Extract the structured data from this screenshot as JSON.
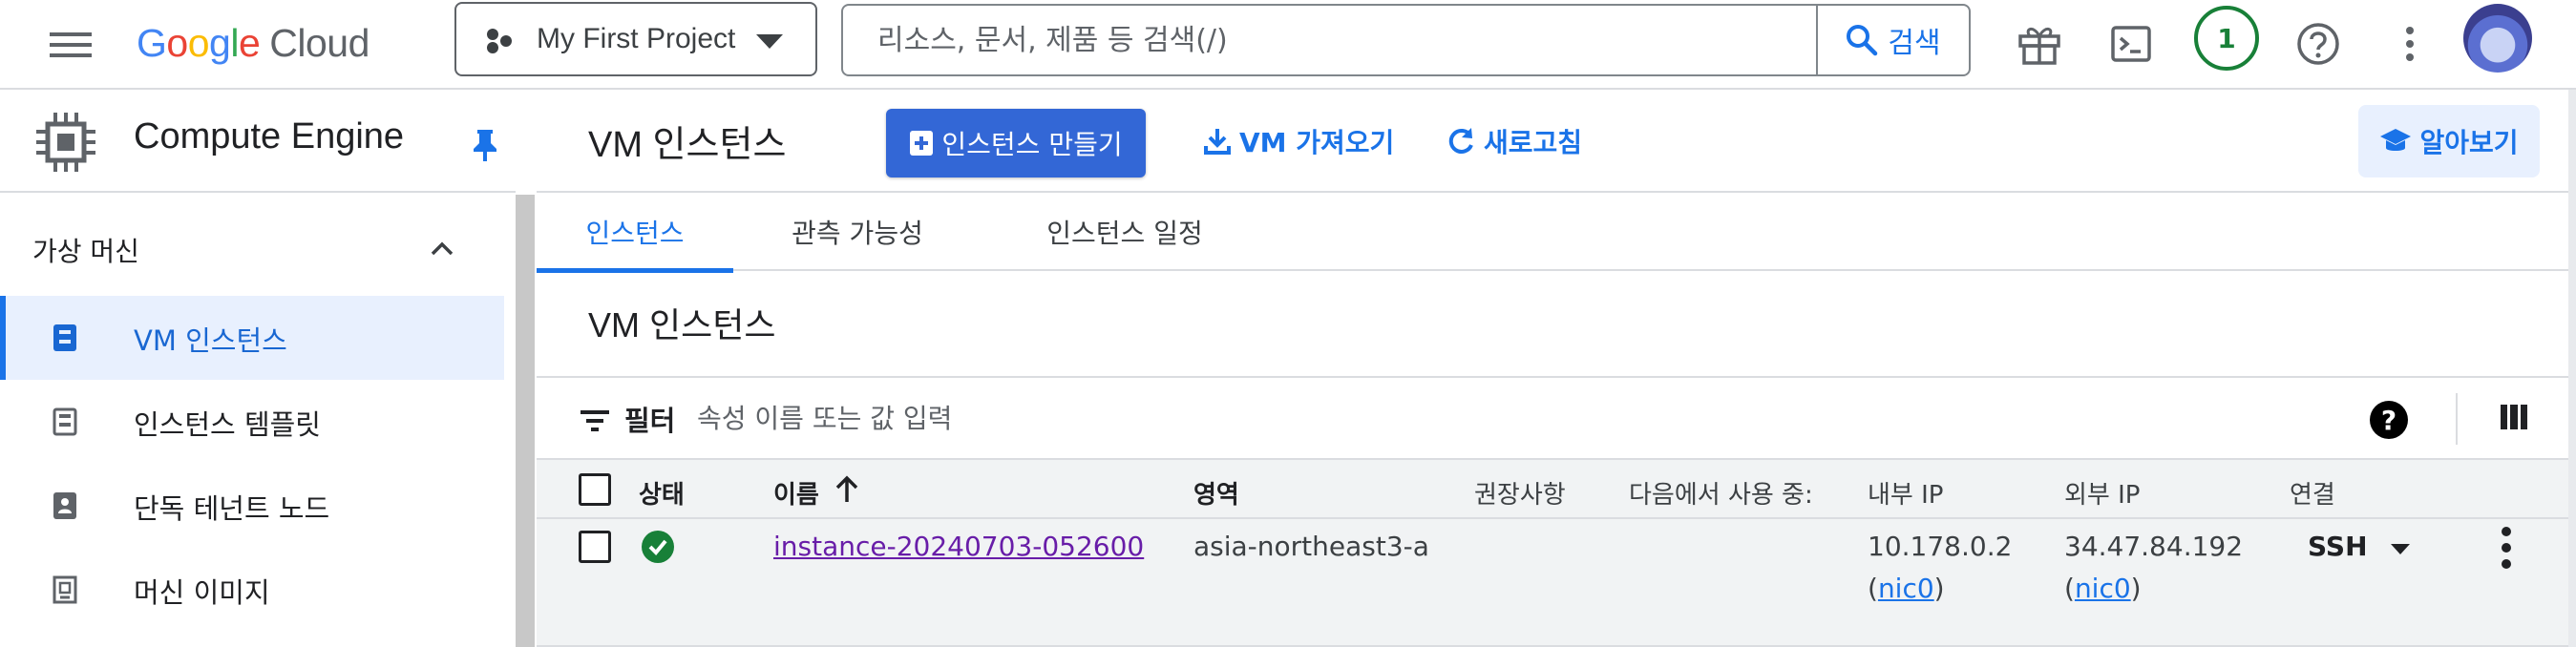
{
  "header": {
    "logo_google": "Google",
    "logo_cloud": "Cloud",
    "project_name": "My First Project",
    "search_placeholder": "리소스, 문서, 제품 등 검색(/)",
    "search_button": "검색",
    "notification_count": "1"
  },
  "sidebar": {
    "product_title": "Compute Engine",
    "section_label": "가상 머신",
    "items": [
      {
        "label": "VM 인스턴스",
        "icon": "vm-instance-icon",
        "active": true
      },
      {
        "label": "인스턴스 템플릿",
        "icon": "template-icon",
        "active": false
      },
      {
        "label": "단독 테넌트 노드",
        "icon": "sole-tenant-icon",
        "active": false
      },
      {
        "label": "머신 이미지",
        "icon": "machine-image-icon",
        "active": false
      }
    ]
  },
  "toolbar": {
    "page_title": "VM 인스턴스",
    "create_label": "인스턴스 만들기",
    "import_label": "VM 가져오기",
    "refresh_label": "새로고침",
    "learn_label": "알아보기"
  },
  "tabs": [
    "인스턴스",
    "관측 가능성",
    "인스턴스 일정"
  ],
  "section_title": "VM 인스턴스",
  "filter": {
    "label": "필터",
    "placeholder": "속성 이름 또는 값 입력"
  },
  "table": {
    "columns": [
      "상태",
      "이름",
      "영역",
      "권장사항",
      "다음에서 사용 중:",
      "내부 IP",
      "외부 IP",
      "연결"
    ],
    "rows": [
      {
        "status": "running",
        "name": "instance-20240703-052600",
        "zone": "asia-northeast3-a",
        "recommendation": "",
        "in_use_by": "",
        "internal_ip": "10.178.0.2",
        "internal_nic": "nic0",
        "external_ip": "34.47.84.192",
        "external_nic": "nic0",
        "connect": "SSH"
      }
    ]
  },
  "colors": {
    "accent": "#1a73e8",
    "primary_button": "#3367d6",
    "status_ok": "#188038",
    "link_visited": "#681da8"
  }
}
